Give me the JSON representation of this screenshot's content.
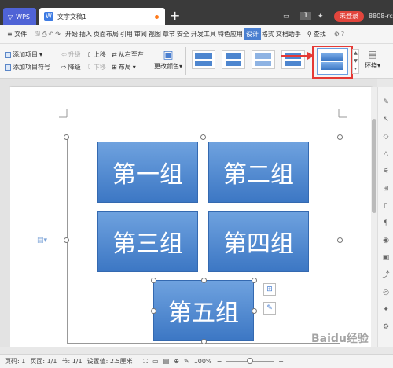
{
  "titlebar": {
    "app_tab": "WPS",
    "doc_tab": "文字文稿1",
    "new_tab": "+",
    "page_count": "1",
    "login": "未登录",
    "user_code": "8808-rc"
  },
  "menubar": {
    "file": "≡ 文件",
    "items": [
      "开始",
      "插入",
      "页面布局",
      "引用",
      "审阅",
      "视图",
      "章节",
      "安全",
      "开发工具",
      "特色应用",
      "设计",
      "格式",
      "文档助手"
    ],
    "active": "设计",
    "search": "查找"
  },
  "ribbon": {
    "add_item": "添加项目",
    "add_bullet": "添加项目符号",
    "promote": "升级",
    "demote": "降级",
    "move_up": "上移",
    "move_down": "下移",
    "rtl": "从右至左",
    "layout": "布局",
    "change_color": "更改颜色",
    "wrap": "环绕"
  },
  "diagram": {
    "tiles": [
      "第一组",
      "第二组",
      "第三组",
      "第四组",
      "第五组"
    ]
  },
  "statusbar": {
    "page_label": "页码: 1",
    "pages_label": "页面: 1/1",
    "section_label": "节: 1/1",
    "setting_label": "设置值: 2.5厘米",
    "zoom": "100%"
  },
  "watermark": "Baidu经验",
  "colors": {
    "accent": "#4a7fd0",
    "tile": "#4e86cf",
    "arrow": "#e53935"
  }
}
